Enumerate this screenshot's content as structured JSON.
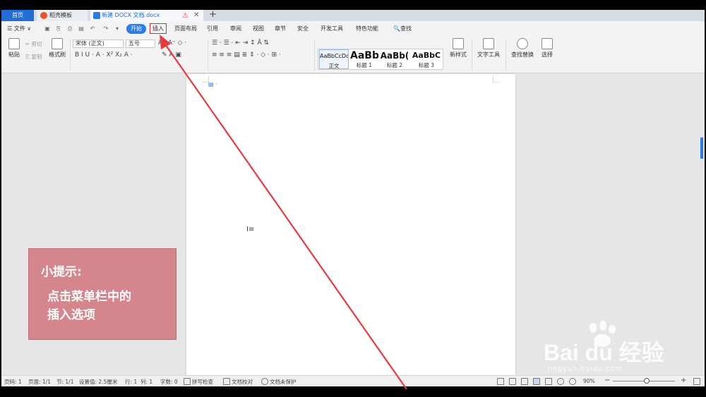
{
  "tabbar": {
    "home_label": "首页",
    "template_label": "稻壳模板",
    "doc_label": "新建 DOCX 文档.docx",
    "warn_icon": "warning-icon",
    "close_glyph": "✕",
    "add_glyph": "+"
  },
  "menu": {
    "file_label": "☰ 文件 ∨",
    "tabs": [
      "开始",
      "插入",
      "页面布局",
      "引用",
      "审阅",
      "视图",
      "章节",
      "安全",
      "开发工具",
      "特色功能"
    ],
    "search_label": "🔍查找",
    "highlighted_tab": "插入"
  },
  "ribbon": {
    "paste": "粘贴",
    "cut": "剪切",
    "copy": "复制",
    "format_painter": "格式刷",
    "font_name": "宋体 (正文)",
    "font_size": "五号",
    "format_row": "B  I  U · A · X²  X₂  A · ",
    "styles": [
      {
        "preview": "AaBbCcDd",
        "name": "正文"
      },
      {
        "preview": "AaBb",
        "name": "标题 1"
      },
      {
        "preview": "AaBb(",
        "name": "标题 2"
      },
      {
        "preview": "AaBbC",
        "name": "标题 3"
      }
    ],
    "new_style": "新样式",
    "text_tools": "文字工具",
    "find_replace": "查找替换",
    "select": "选择"
  },
  "tip": {
    "title": "小提示:",
    "line1": "点击菜单栏中的",
    "line2": "插入选项"
  },
  "watermark": {
    "text": "Bai du 经验",
    "url": "jingyan.baidu.com"
  },
  "status": {
    "page_num": "页码: 1",
    "pages": "页面: 1/1",
    "section": "节: 1/1",
    "setting": "设置值: 2.5厘米",
    "row": "行: 1",
    "col": "列: 1",
    "words": "字数: 0",
    "spell": "拼写检查",
    "proof": "文档校对",
    "protect": "文档未保护",
    "zoom": "90%",
    "zoom_minus": "−",
    "zoom_plus": "+",
    "zoom_level": 0.55
  },
  "colors": {
    "accent": "#2d7be5",
    "highlight_box": "#e3272c",
    "tip_bg": "#d5868c",
    "arrow": "#e83a3e"
  }
}
